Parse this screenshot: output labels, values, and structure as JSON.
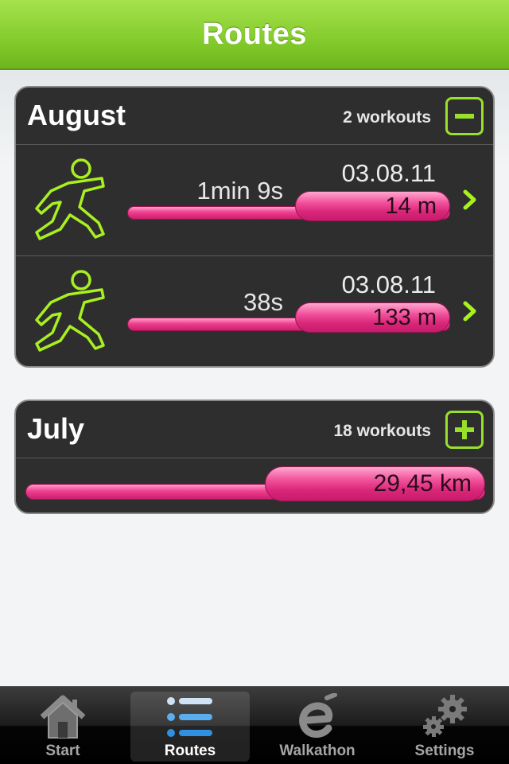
{
  "header": {
    "title": "Routes"
  },
  "colors": {
    "accent_green": "#99e02a",
    "bar_pink": "#ef3f8f",
    "card_bg": "#2e2e2f"
  },
  "months": [
    {
      "name": "August",
      "workouts_label": "2 workouts",
      "toggle_icon": "collapse-minus-icon",
      "expanded": true,
      "workouts": [
        {
          "icon": "runner-icon",
          "duration": "1min 9s",
          "date": "03.08.11",
          "distance": "14 m",
          "bar_fraction": 0.48
        },
        {
          "icon": "runner-icon",
          "duration": "38s",
          "date": "03.08.11",
          "distance": "133 m",
          "bar_fraction": 0.48
        }
      ]
    },
    {
      "name": "July",
      "workouts_label": "18 workouts",
      "toggle_icon": "expand-plus-icon",
      "expanded": false,
      "total_distance": "29,45 km",
      "bar_fraction": 0.48
    }
  ],
  "tabs": [
    {
      "label": "Start",
      "icon": "home-icon",
      "active": false
    },
    {
      "label": "Routes",
      "icon": "list-icon",
      "active": true
    },
    {
      "label": "Walkathon",
      "icon": "walkathon-e-icon",
      "active": false
    },
    {
      "label": "Settings",
      "icon": "gears-icon",
      "active": false
    }
  ]
}
